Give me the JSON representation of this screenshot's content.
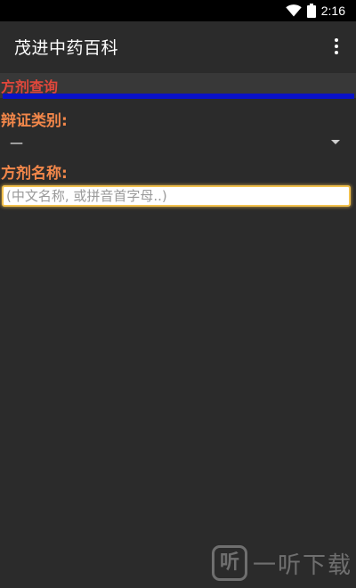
{
  "status_bar": {
    "time": "2:16",
    "icons": [
      "wifi-icon",
      "battery-icon"
    ]
  },
  "app_bar": {
    "title": "茂进中药百科",
    "menu_icon": "overflow-menu-icon"
  },
  "section": {
    "title": "方剂查询"
  },
  "form": {
    "category_label": "辩证类别:",
    "category_value": "—",
    "name_label": "方剂名称:",
    "name_placeholder": "(中文名称, 或拼音首字母..)",
    "name_value": ""
  },
  "watermark": {
    "logo_text": "听",
    "text": "一听下载"
  },
  "colors": {
    "background": "#2b2b2b",
    "section_title": "#e0473b",
    "label": "#f2874a",
    "accent_bar": "#0a12c8",
    "input_border": "#f2c14e"
  }
}
